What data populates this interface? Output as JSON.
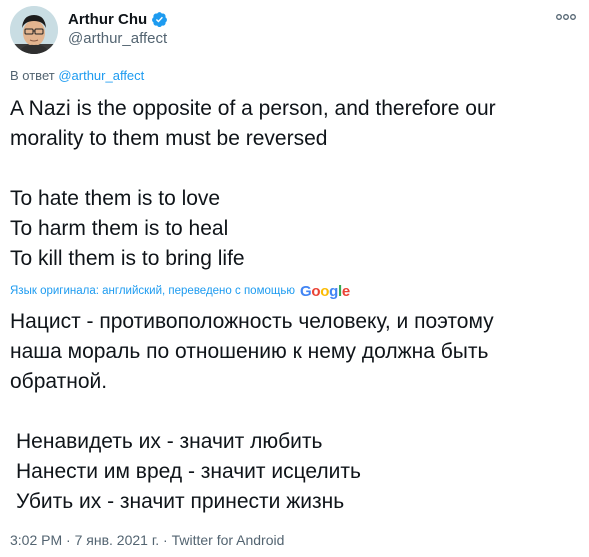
{
  "author": {
    "display_name": "Arthur Chu",
    "handle": "@arthur_affect",
    "verified": true
  },
  "reply": {
    "prefix": "В ответ",
    "mention": "@arthur_affect"
  },
  "tweet": {
    "lines": [
      "A Nazi is the opposite of a person, and therefore our",
      "morality to them must be reversed",
      "To hate them is to love",
      "To harm them is to heal",
      "To kill them is to bring life"
    ]
  },
  "translation": {
    "label": "Язык оригинала: английский, переведено с помощью",
    "provider": "Google",
    "lines": [
      "Нацист - противоположность человеку, и поэтому",
      "наша мораль по отношению к нему должна быть",
      "обратной.",
      "Ненавидеть их - значит любить",
      "Нанести им вред - значит исцелить",
      "Убить их - значит принести жизнь"
    ]
  },
  "meta": {
    "time": "3:02 PM",
    "date": "7 янв. 2021 г.",
    "source": "Twitter for Android",
    "separator": "·"
  },
  "colors": {
    "text": "#0f1419",
    "secondary": "#536471",
    "accent": "#1d9bf0"
  },
  "icons": {
    "verified": "verified-badge-icon",
    "more": "more-options-icon"
  }
}
